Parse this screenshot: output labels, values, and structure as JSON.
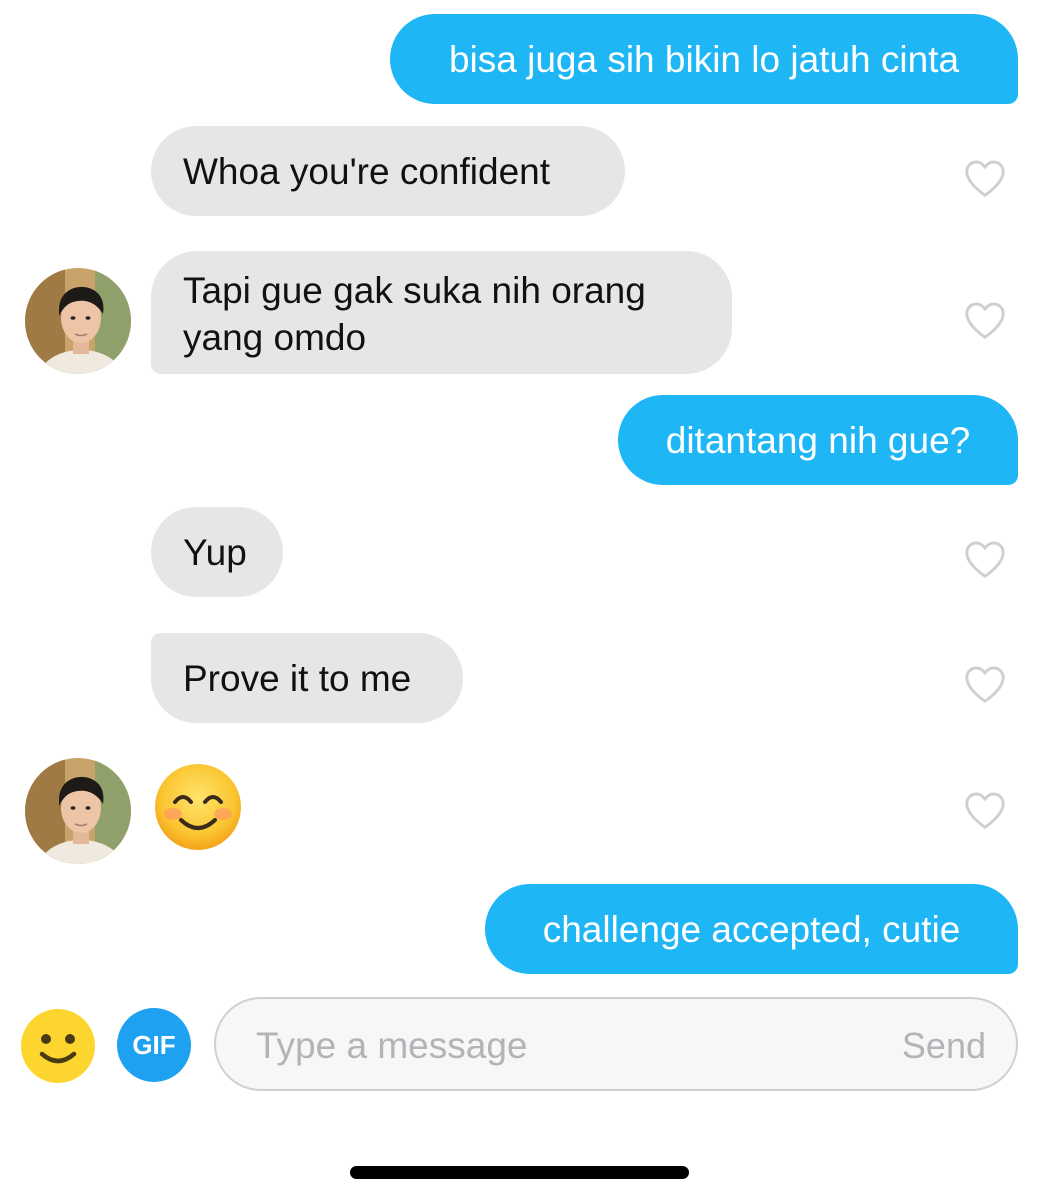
{
  "colors": {
    "sent_bubble": "#1fb6f6",
    "received_bubble": "#e6e6e6",
    "gif_button": "#1fa1f2"
  },
  "messages": [
    {
      "direction": "sent",
      "text": "bisa juga sih bikin lo jatuh cinta"
    },
    {
      "direction": "received",
      "text": "Whoa you're confident",
      "liked": false
    },
    {
      "direction": "received",
      "text": "Tapi gue gak suka nih orang yang omdo",
      "liked": false
    },
    {
      "direction": "sent",
      "text": "ditantang nih gue?"
    },
    {
      "direction": "received",
      "text": "Yup",
      "liked": false
    },
    {
      "direction": "received",
      "text": "Prove it to me",
      "liked": false
    },
    {
      "direction": "received",
      "text": "😊",
      "kind": "emoji",
      "icon": "smiling-face-emoji",
      "liked": false
    },
    {
      "direction": "sent",
      "text": "challenge accepted, cutie"
    }
  ],
  "composer": {
    "emoji_icon": "smiley-face-icon",
    "gif_label": "GIF",
    "placeholder": "Type a message",
    "value": "",
    "send_label": "Send"
  }
}
